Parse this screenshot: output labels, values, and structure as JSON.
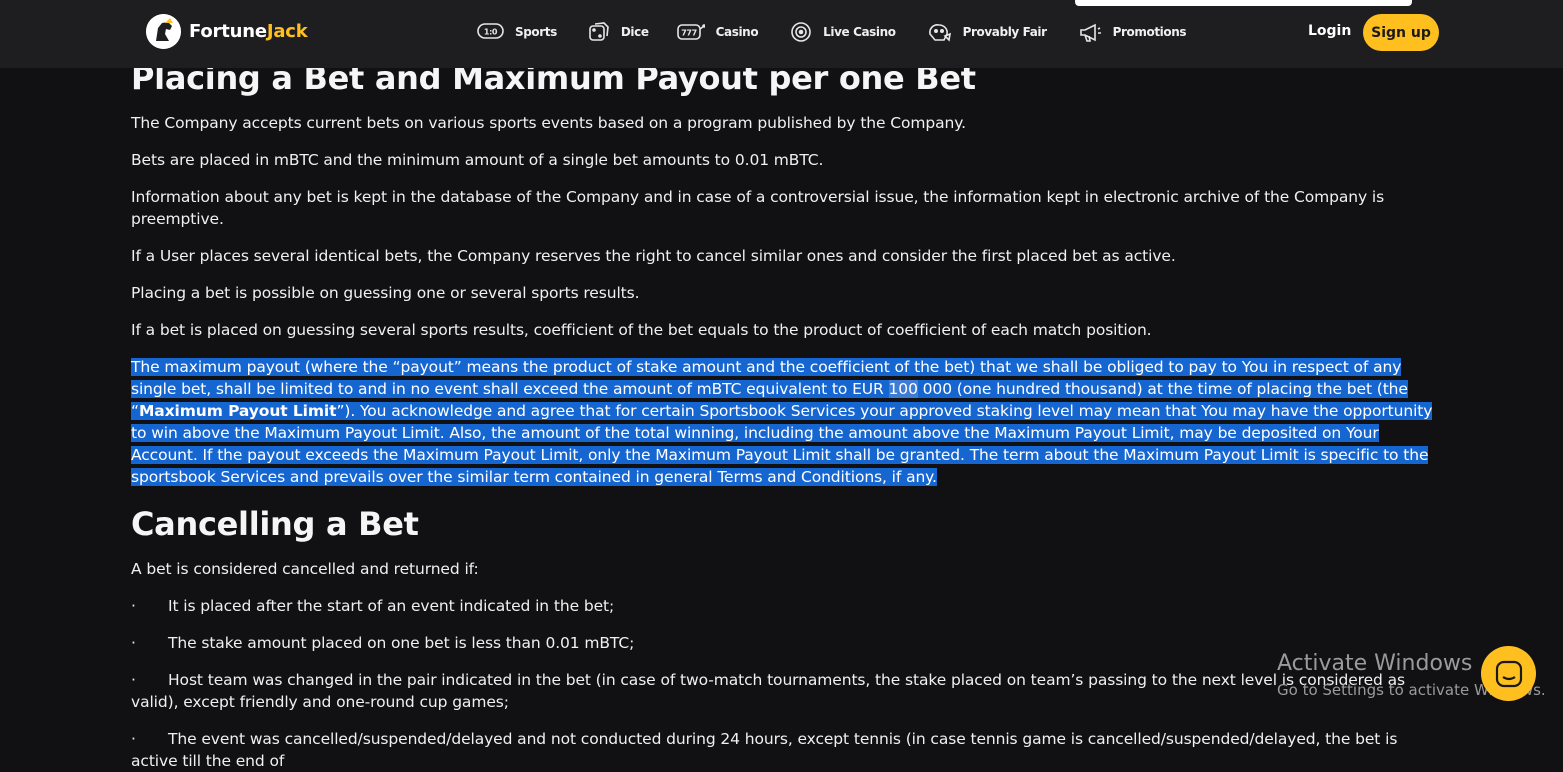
{
  "header": {
    "logo_text_a": "Fortune",
    "logo_text_b": "Jack",
    "nav": [
      {
        "label": "Sports",
        "icon": "sports-icon"
      },
      {
        "label": "Dice",
        "icon": "dice-icon"
      },
      {
        "label": "Casino",
        "icon": "slot-machine-icon"
      },
      {
        "label": "Live Casino",
        "icon": "live-casino-chip-icon"
      },
      {
        "label": "Provably Fair",
        "icon": "provably-fair-icon"
      },
      {
        "label": "Promotions",
        "icon": "megaphone-icon"
      }
    ],
    "login_label": "Login",
    "signup_label": "Sign up"
  },
  "colors": {
    "accent": "#ffc01f",
    "background": "#111113",
    "header": "#1e1e20",
    "selection": "#1666d2"
  },
  "section1": {
    "title": "Placing a Bet and Maximum Payout per one Bet",
    "paragraphs": [
      "The Company accepts current bets on various sports events based on a program published by the Company.",
      "Bets are placed in mBTC and the minimum amount of a single bet amounts to 0.01 mBTC.",
      "Information about any bet is kept in the database of the Company and in case of a controversial issue, the information kept in electronic archive of the Company is preemptive.",
      "If a User places several identical bets, the Company reserves the right to cancel similar ones and consider the first placed bet as active.",
      "Placing a bet is possible on guessing one or several sports results.",
      "If a bet is placed on guessing several sports results, coefficient of the bet equals to the product of coefficient of each match position."
    ],
    "highlighted": {
      "part1": "The maximum payout (where the “payout” means the product of stake amount and the coefficient of the bet) that we shall be obliged to pay to You in respect of any single bet, shall be limited to and in no event shall exceed the amount of mBTC equivalent to EUR ",
      "part2": "100",
      "part3": " 000 (one hundred thousand) at the time of placing the bet (the “",
      "bold": "Maximum Payout Limit",
      "part4": "”). You acknowledge and agree that for certain Sportsbook Services your approved staking level may mean that You may have the opportunity to win above the Maximum Payout Limit. Also, the amount of the total winning, including the amount above the Maximum Payout Limit, may be deposited on Your Account. If the payout exceeds the Maximum Payout Limit, only the Maximum Payout Limit shall be granted. The term about the Maximum Payout Limit is specific to the sportsbook Services and prevails over the similar term contained in general Terms and Conditions, if any."
    }
  },
  "section2": {
    "title": "Cancelling a Bet",
    "intro": "A bet is considered cancelled and returned if:",
    "bullet_char": "·",
    "items": [
      "It is placed after the start of an event indicated in the bet;",
      "The stake amount placed on one bet is less than 0.01 mBTC;",
      "Host team was changed in the pair indicated in the bet (in case of two-match tournaments, the stake placed on team’s passing to the next level is considered as valid), except friendly and one-round cup games;",
      "The event was cancelled/suspended/delayed and not conducted during 24 hours, except tennis (in case tennis game is cancelled/suspended/delayed, the bet is active till the end of"
    ]
  },
  "watermark": {
    "title": "Activate Windows",
    "subtitle": "Go to Settings to activate Windows."
  },
  "chat": {
    "icon": "chat-icon"
  }
}
